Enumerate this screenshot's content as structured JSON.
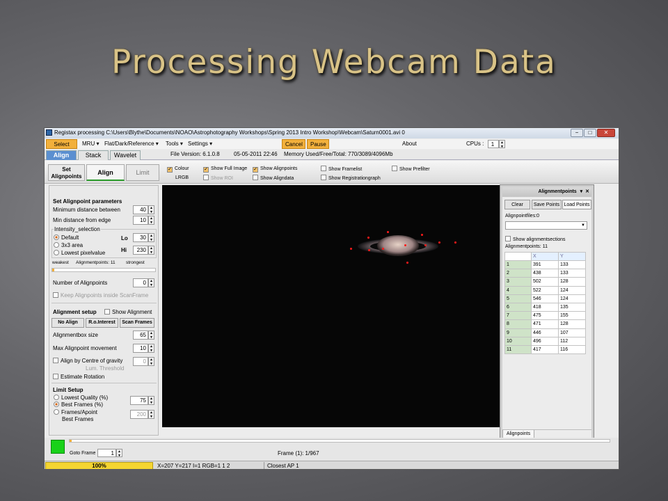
{
  "slide": {
    "title": "Processing Webcam Data"
  },
  "window": {
    "title": "Registax processing C:\\Users\\Blythe\\Documents\\NOAO\\Astrophotography Workshops\\Spring 2013 Intro Workshop\\Webcam\\Saturn0001.avi 0",
    "buttons": {
      "minimize": "−",
      "maximize": "□",
      "close": "✕"
    }
  },
  "menu": {
    "select": "Select",
    "mru": "MRU ▾",
    "flat": "Flat/Dark/Reference ▾",
    "tools": "Tools ▾",
    "settings": "Settings ▾",
    "cancel": "Cancel",
    "pause": "Pause",
    "about": "About",
    "cpus_label": "CPUs :",
    "cpus_value": "1"
  },
  "tabs": {
    "align": "Align",
    "stack": "Stack",
    "wavelet": "Wavelet"
  },
  "info": {
    "version": "File Version: 6.1.0.8",
    "date": "05-05-2011 22:46",
    "memory": "Memory Used/Free/Total: 770/3089/4096Mb"
  },
  "toolbar": {
    "set_alignpoints": "Set Alignpoints",
    "align": "Align",
    "limit": "Limit",
    "checkboxes": {
      "colour": "Colour",
      "lrgb": "LRGB",
      "show_full_image": "Show Full Image",
      "show_roi": "Show ROI",
      "show_alignpoints": "Show Alignpoints",
      "show_aligndata": "Show Aligndata",
      "show_framelist": "Show Framelist",
      "show_registrationgraph": "Show Registrationgraph",
      "show_prefilter": "Show Prefilter"
    }
  },
  "params": {
    "heading": "Set Alignpoint parameters",
    "min_distance_between": {
      "label": "Minimum distance between",
      "value": "40"
    },
    "min_distance_edge": {
      "label": "Min distance from edge",
      "value": "10"
    },
    "intensity_heading": "Intensity_selection",
    "default": "Default",
    "area3x3": "3x3 area",
    "lowest": "Lowest pixelvalue",
    "lo": {
      "label": "Lo",
      "value": "30"
    },
    "hi": {
      "label": "Hi",
      "value": "230"
    },
    "weakest": "weakest",
    "alignpoints_count": "Alignmentpoints: 11",
    "strongest": "strongest",
    "num_alignpoints": {
      "label": "Number of Alignpoints",
      "value": "0"
    },
    "keep_inside": "Keep Alignpoints inside ScanFrame",
    "alignment_setup": "Alignment setup",
    "show_alignment": "Show Alignment",
    "no_align": "No Align",
    "roi": "R.o.Interest",
    "scan_frames": "Scan Frames",
    "box_size": {
      "label": "Alignmentbox size",
      "value": "65"
    },
    "max_movement": {
      "label": "Max Alignpoint movement",
      "value": "10"
    },
    "centre_gravity": {
      "label": "Align by Centre of gravity",
      "value": "0"
    },
    "lum_threshold": "Lum. Threshold",
    "estimate_rotation": "Estimate Rotation",
    "limit_setup": "Limit Setup",
    "lowest_quality": "Lowest Quality (%)",
    "best_frames_pct": {
      "label": "Best Frames (%)",
      "value": "75"
    },
    "frames_apoint": "Frames/Apoint",
    "best_frames": {
      "label": "Best Frames",
      "value": "200"
    }
  },
  "alignpanel": {
    "title": "Alignmentpoints",
    "pin": "▾",
    "close": "✕",
    "clear": "Clear",
    "save": "Save Points",
    "load": "Load Points",
    "files": "Alignpointfiles:0",
    "show_sections": "Show alignmentsections",
    "count": "Alignmentpoints: 11",
    "col_x": "X",
    "col_y": "Y",
    "rows": [
      [
        "1",
        "391",
        "133"
      ],
      [
        "2",
        "438",
        "133"
      ],
      [
        "3",
        "502",
        "128"
      ],
      [
        "4",
        "522",
        "124"
      ],
      [
        "5",
        "546",
        "124"
      ],
      [
        "6",
        "418",
        "135"
      ],
      [
        "7",
        "475",
        "155"
      ],
      [
        "8",
        "471",
        "128"
      ],
      [
        "9",
        "446",
        "107"
      ],
      [
        "10",
        "496",
        "112"
      ],
      [
        "11",
        "417",
        "116"
      ]
    ],
    "footer_tab": "Alignpoints"
  },
  "bottom": {
    "goto_frame": "Goto Frame",
    "goto_value": "1",
    "frame": "Frame (1): 1/967"
  },
  "status": {
    "progress": "100%",
    "progress_value": 1.0,
    "coords": "X=207 Y=217 I=1 RGB=1 1 2",
    "closest": "Closest AP 1"
  },
  "colors": {
    "title_gold": "#d9c387",
    "accent_orange": "#f2b03c",
    "tab_blue": "#5b8fd0",
    "progress_yellow": "#f5d531",
    "indicator_green": "#19d21a"
  }
}
